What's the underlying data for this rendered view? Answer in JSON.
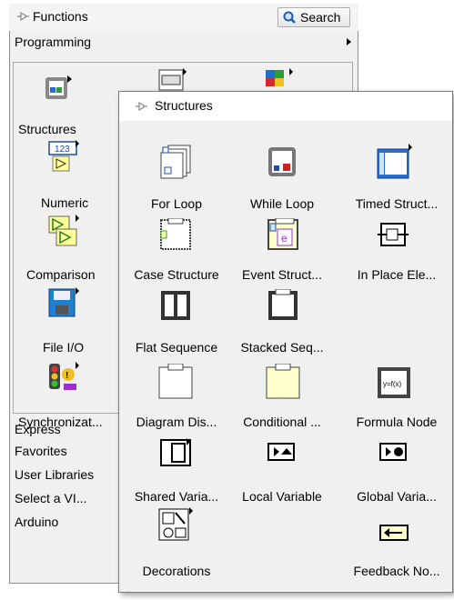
{
  "palette": {
    "title": "Functions",
    "search_label": "Search",
    "category": "Programming",
    "subcategories": [
      "Structures",
      "Numeric",
      "Comparison",
      "File I/O",
      "Synchronizat..."
    ],
    "other_categories": [
      "Express",
      "Favorites",
      "User Libraries",
      "Select a VI...",
      "Arduino"
    ]
  },
  "structures": {
    "title": "Structures",
    "items": [
      "For Loop",
      "While Loop",
      "Timed Struct...",
      "Case Structure",
      "Event Struct...",
      "In Place Ele...",
      "Flat Sequence",
      "Stacked Seq...",
      "Diagram Dis...",
      "Conditional ...",
      "Formula Node",
      "Shared Varia...",
      "Local Variable",
      "Global Varia...",
      "Decorations",
      "Feedback No..."
    ],
    "numeric_text": "123",
    "formula_text": "y=f(x)"
  },
  "colors": {
    "selection": "#3399ff",
    "bg": "#f0f0f0"
  }
}
